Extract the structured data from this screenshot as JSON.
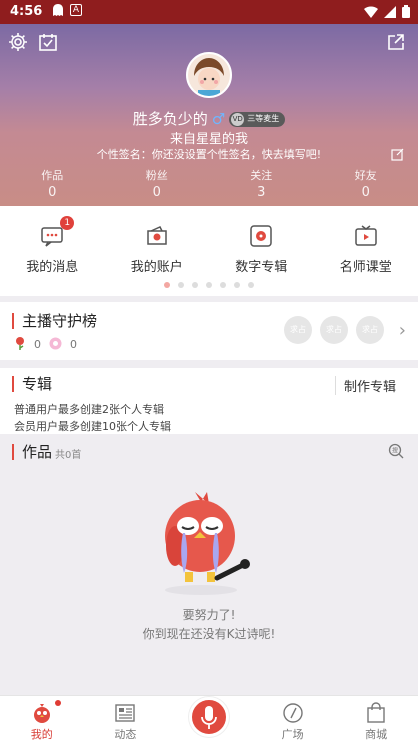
{
  "status_bar": {
    "time": "4:56",
    "notif_letter": "A"
  },
  "profile": {
    "nickname": "胜多负少的",
    "gender_symbol": "♂",
    "badge_level": "VD",
    "badge_text": "三等麦生",
    "origin": "来自星星的我",
    "signature": "个性签名：你还没设置个性签名，快去填写吧!"
  },
  "stats": [
    {
      "label": "作品",
      "value": "0"
    },
    {
      "label": "粉丝",
      "value": "0"
    },
    {
      "label": "关注",
      "value": "3"
    },
    {
      "label": "好友",
      "value": "0"
    }
  ],
  "quick_actions": [
    {
      "label": "我的消息",
      "icon": "message-icon",
      "badge": "1"
    },
    {
      "label": "我的账户",
      "icon": "wallet-icon"
    },
    {
      "label": "数字专辑",
      "icon": "record-icon"
    },
    {
      "label": "名师课堂",
      "icon": "video-icon"
    }
  ],
  "carousel": {
    "pages": 7,
    "active": 0
  },
  "guard": {
    "title": "主播守护榜",
    "flowers": "0",
    "gifts": "0",
    "seat_label": "求占"
  },
  "album": {
    "title": "专辑",
    "make_label": "制作专辑",
    "tip1": "普通用户最多创建2张个人专辑",
    "tip2": "会员用户最多创建10张个人专辑"
  },
  "works": {
    "title": "作品",
    "count": "共0首",
    "search_icon_label": "搜"
  },
  "empty": {
    "line1": "要努力了!",
    "line2": "你到现在还没有K过诗呢!"
  },
  "tabs": [
    {
      "label": "我的",
      "icon": "profile-bird-icon",
      "active": true
    },
    {
      "label": "动态",
      "icon": "feed-icon"
    },
    {
      "label": "",
      "icon": "mic-icon"
    },
    {
      "label": "广场",
      "icon": "compass-icon"
    },
    {
      "label": "商城",
      "icon": "shop-bag-icon"
    }
  ],
  "colors": {
    "accent": "#e04a3f",
    "statusbar": "#8f1d1e"
  }
}
